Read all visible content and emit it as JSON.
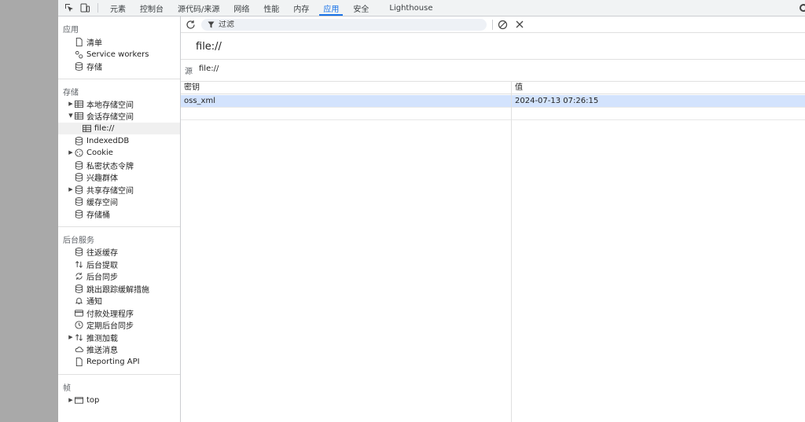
{
  "toolbar": {
    "tabs": [
      {
        "label": "元素"
      },
      {
        "label": "控制台"
      },
      {
        "label": "源代码/来源"
      },
      {
        "label": "网络"
      },
      {
        "label": "性能"
      },
      {
        "label": "内存"
      },
      {
        "label": "应用"
      },
      {
        "label": "安全"
      },
      {
        "label": "Lighthouse"
      }
    ],
    "active_tab": "应用"
  },
  "sidebar": {
    "app_section": {
      "title": "应用",
      "items": [
        {
          "label": "清单",
          "icon": "document-icon"
        },
        {
          "label": "Service workers",
          "icon": "gears-icon"
        },
        {
          "label": "存储",
          "icon": "database-icon"
        }
      ]
    },
    "storage_section": {
      "title": "存储",
      "items": [
        {
          "label": "本地存储空间",
          "icon": "table-icon",
          "expand": "collapsed"
        },
        {
          "label": "会话存储空间",
          "icon": "table-icon",
          "expand": "expanded"
        },
        {
          "label": "file://",
          "icon": "table-icon",
          "selected": true
        },
        {
          "label": "IndexedDB",
          "icon": "database-icon"
        },
        {
          "label": "Cookie",
          "icon": "cookie-icon",
          "expand": "collapsed"
        },
        {
          "label": "私密状态令牌",
          "icon": "database-icon"
        },
        {
          "label": "兴趣群体",
          "icon": "database-icon"
        },
        {
          "label": "共享存储空间",
          "icon": "database-icon",
          "expand": "collapsed"
        },
        {
          "label": "缓存空间",
          "icon": "database-icon"
        },
        {
          "label": "存储桶",
          "icon": "database-icon"
        }
      ]
    },
    "background_section": {
      "title": "后台服务",
      "items": [
        {
          "label": "往返缓存",
          "icon": "database-icon"
        },
        {
          "label": "后台提取",
          "icon": "up-down-arrows-icon"
        },
        {
          "label": "后台同步",
          "icon": "sync-icon"
        },
        {
          "label": "跳出跟踪缓解措施",
          "icon": "database-icon"
        },
        {
          "label": "通知",
          "icon": "bell-icon"
        },
        {
          "label": "付款处理程序",
          "icon": "card-icon"
        },
        {
          "label": "定期后台同步",
          "icon": "clock-icon"
        },
        {
          "label": "推测加载",
          "icon": "up-down-arrows-icon",
          "expand": "collapsed"
        },
        {
          "label": "推送消息",
          "icon": "cloud-icon"
        },
        {
          "label": "Reporting API",
          "icon": "document-icon"
        }
      ]
    },
    "frames_section": {
      "title": "帧",
      "items": [
        {
          "label": "top",
          "icon": "window-icon",
          "expand": "collapsed"
        }
      ]
    }
  },
  "main": {
    "filter_placeholder": "过滤",
    "page_title": "file://",
    "origin_label": "源",
    "origin_value": "file://",
    "table": {
      "columns": [
        "密钥",
        "值"
      ],
      "rows": [
        {
          "key": "oss_xml",
          "value": "2024-07-13 07:26:15",
          "selected": true
        }
      ]
    }
  },
  "colors": {
    "accent": "#1a73e8",
    "selected_row": "#d3e3fd",
    "toolbar_bg": "#f1f3f4"
  }
}
